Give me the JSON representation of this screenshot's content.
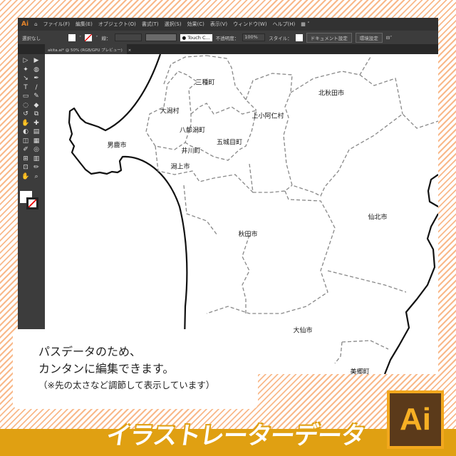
{
  "menubar": {
    "logo": "Ai",
    "items": [
      "ファイル(F)",
      "編集(E)",
      "オブジェクト(O)",
      "書式(T)",
      "選択(S)",
      "効果(C)",
      "表示(V)",
      "ウィンドウ(W)",
      "ヘルプ(H)"
    ]
  },
  "control": {
    "selection": "選択なし",
    "stroke_label": "線：",
    "brush": "Touch C...",
    "opacity_label": "不透明度：",
    "opacity": "100%",
    "style_label": "スタイル：",
    "doc_settings": "ドキュメント設定",
    "prefs": "環境設定"
  },
  "tab": {
    "title": "akita.ai* @ 50% (RGB/GPU プレビュー)",
    "close": "×"
  },
  "map": {
    "labels": [
      "三種町",
      "北秋田市",
      "大潟村",
      "上小阿仁村",
      "八郎潟町",
      "五城目町",
      "男鹿市",
      "井川町",
      "潟上市",
      "仙北市",
      "秋田市",
      "大仙市",
      "美郷町"
    ]
  },
  "note": {
    "line1": "パスデータのため、",
    "line2": "カンタンに編集できます。",
    "line3": "（※先の太さなど調節して表示しています）"
  },
  "banner": {
    "title": "イラストレーターデータ",
    "logo": "Ai"
  },
  "colors": {
    "stripe": "#f9b98a",
    "band": "#e0a012",
    "logo_bg": "#5b3a1a",
    "logo_fg": "#f7b024"
  }
}
